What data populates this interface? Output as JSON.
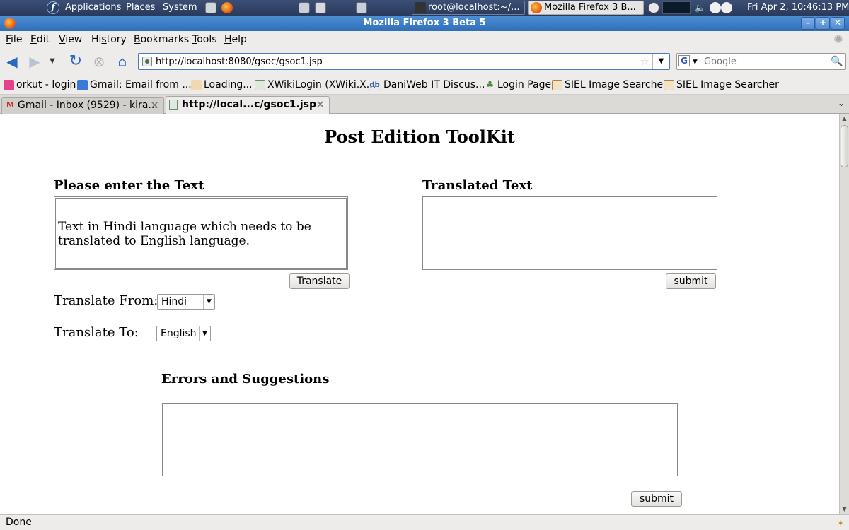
{
  "panel": {
    "menus": [
      "Applications",
      "Places",
      "System"
    ],
    "tasks": [
      {
        "label": "root@localhost:~/..."
      },
      {
        "label": "Mozilla Firefox 3 B..."
      }
    ],
    "clock": "Fri Apr  2, 10:46:13 PM"
  },
  "window": {
    "title": "Mozilla Firefox 3 Beta 5"
  },
  "menubar": {
    "items": [
      {
        "key": "F",
        "rest": "ile"
      },
      {
        "key": "E",
        "rest": "dit"
      },
      {
        "key": "V",
        "rest": "iew"
      },
      {
        "pre": "Hi",
        "key": "s",
        "rest": "tory"
      },
      {
        "key": "B",
        "rest": "ookmarks"
      },
      {
        "key": "T",
        "rest": "ools"
      },
      {
        "key": "H",
        "rest": "elp"
      }
    ]
  },
  "navbar": {
    "url": "http://localhost:8080/gsoc/gsoc1.jsp",
    "search_placeholder": "Google",
    "search_engine_letter": "G"
  },
  "bookmarks": [
    {
      "label": "orkut - login",
      "icon": "orkut-icon",
      "color": "#e8418c"
    },
    {
      "label": "Gmail: Email from ...",
      "icon": "google-icon",
      "color": "#3a7bd5"
    },
    {
      "label": "Loading...",
      "icon": "loading-icon",
      "color": "#d08b3a"
    },
    {
      "label": "XWikiLogin (XWiki.X...",
      "icon": "page-icon",
      "color": "#6b8f6b"
    },
    {
      "label": "DaniWeb IT Discus...",
      "icon": "daniweb-icon",
      "color": "#3060b0"
    },
    {
      "label": "Login Page",
      "icon": "leaf-icon",
      "color": "#4d8a3a"
    },
    {
      "label": "SIEL Image Searcher",
      "icon": "image-icon",
      "color": "#b0803a"
    },
    {
      "label": "SIEL Image Searcher",
      "icon": "image-icon",
      "color": "#b0803a"
    }
  ],
  "tabs": [
    {
      "label": "Gmail - Inbox (9529) - kira...",
      "active": false,
      "icon": "gmail-icon"
    },
    {
      "label": "http://local...c/gsoc1.jsp",
      "active": true,
      "icon": "page-icon"
    }
  ],
  "page": {
    "title": "Post Edition ToolKit",
    "input_heading": "Please enter the Text",
    "input_text": "Text in Hindi language which needs to be translated to English language.",
    "translate_button": "Translate",
    "translated_heading": "Translated Text",
    "translated_text": "",
    "submit_button_1": "submit",
    "from_label": "Translate From:",
    "from_value": "Hindi",
    "to_label": "Translate To:",
    "to_value": "English",
    "errors_heading": "Errors and Suggestions",
    "errors_text": "",
    "submit_button_2": "submit"
  },
  "status": {
    "text": "Done"
  },
  "colors": {
    "titlebar": "#3f80c8",
    "panel": "#33466c",
    "url_focus_border": "#4a7bc0"
  }
}
